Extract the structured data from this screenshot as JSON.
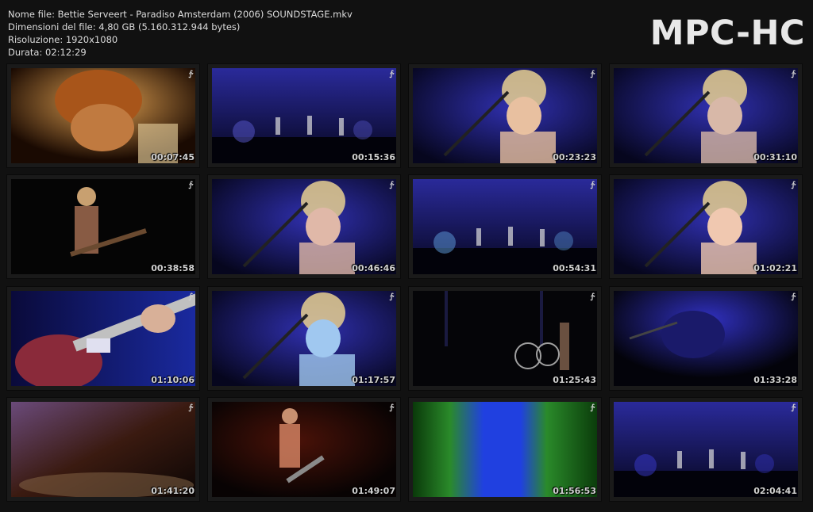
{
  "info": {
    "file_name": "Nome file: Bettie Serveert - Paradiso Amsterdam (2006) SOUNDSTAGE.mkv",
    "file_size": "Dimensioni del file: 4,80 GB (5.160.312.944 bytes)",
    "resolution": "Risoluzione: 1920x1080",
    "duration": "Durata: 02:12:29"
  },
  "brand": "MPC-HC",
  "thumbnails": [
    {
      "timestamp": "00:07:45",
      "scene": "singer-closeup-warm",
      "palette": [
        "#1a0a02",
        "#a8551a",
        "#e0a050"
      ]
    },
    {
      "timestamp": "00:15:36",
      "scene": "wide-stage-blue",
      "palette": [
        "#05051a",
        "#2a2a9a",
        "#5a5ad0"
      ]
    },
    {
      "timestamp": "00:23:23",
      "scene": "guitarist-mic-blue",
      "palette": [
        "#06061e",
        "#3030b0",
        "#e8c0a0"
      ]
    },
    {
      "timestamp": "00:31:10",
      "scene": "singer-mic-blue",
      "palette": [
        "#07071c",
        "#2c2ca6",
        "#d8b8a8"
      ]
    },
    {
      "timestamp": "00:38:58",
      "scene": "guitarist-dark",
      "palette": [
        "#050505",
        "#1a1208",
        "#c08060"
      ]
    },
    {
      "timestamp": "00:46:46",
      "scene": "guitarist-mic-blue",
      "palette": [
        "#0a0a2a",
        "#3a3ab8",
        "#e0b8a8"
      ]
    },
    {
      "timestamp": "00:54:31",
      "scene": "wide-stage-blue",
      "palette": [
        "#040414",
        "#2020a0",
        "#60a0e0"
      ]
    },
    {
      "timestamp": "01:02:21",
      "scene": "singer-closeup-blue",
      "palette": [
        "#08081e",
        "#3a3ac8",
        "#f0c8b0"
      ]
    },
    {
      "timestamp": "01:10:06",
      "scene": "guitar-closeup",
      "palette": [
        "#0a0a3a",
        "#8a2a3a",
        "#e0e0f0"
      ]
    },
    {
      "timestamp": "01:17:57",
      "scene": "singer-mic-blue",
      "palette": [
        "#05051a",
        "#2a4ab8",
        "#a0c8f0"
      ]
    },
    {
      "timestamp": "01:25:43",
      "scene": "band-dark-stage",
      "palette": [
        "#050508",
        "#1a1a40",
        "#a0a0a0"
      ]
    },
    {
      "timestamp": "01:33:28",
      "scene": "singer-dark-blue",
      "palette": [
        "#03030a",
        "#1a1a6a",
        "#3030c0"
      ]
    },
    {
      "timestamp": "01:41:20",
      "scene": "blurred-warm",
      "palette": [
        "#0a0504",
        "#3a1a10",
        "#6a4a7a"
      ]
    },
    {
      "timestamp": "01:49:07",
      "scene": "guitarist-red-stage",
      "palette": [
        "#080303",
        "#4a1208",
        "#d08060"
      ]
    },
    {
      "timestamp": "01:56:53",
      "scene": "blurred-green-blue",
      "palette": [
        "#0a3a0a",
        "#2a8a2a",
        "#2040e0"
      ]
    },
    {
      "timestamp": "02:04:41",
      "scene": "wide-stage-dark-blue",
      "palette": [
        "#020208",
        "#10105a",
        "#3a3ad0"
      ]
    }
  ]
}
